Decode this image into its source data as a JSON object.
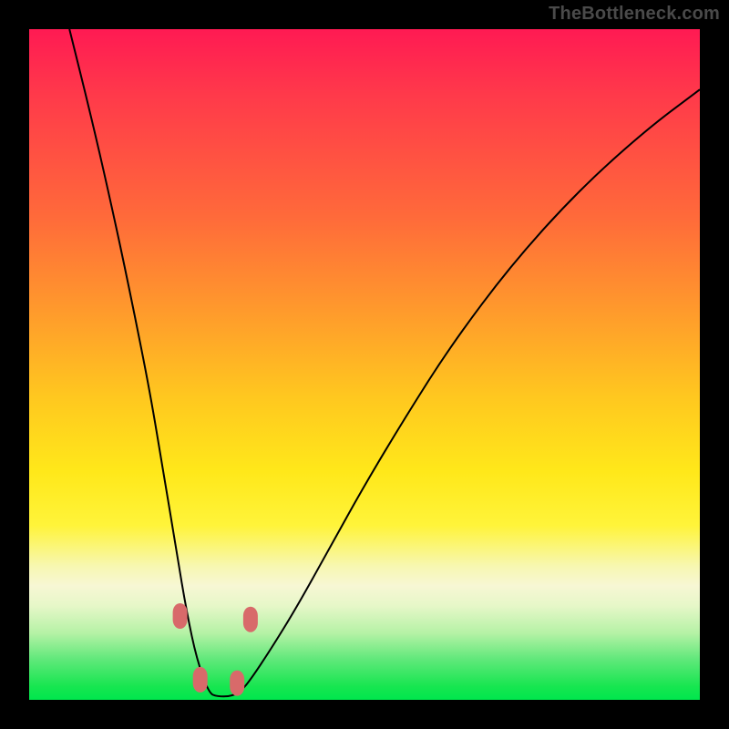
{
  "watermark": "TheBottleneck.com",
  "chart_data": {
    "type": "line",
    "title": "",
    "xlabel": "",
    "ylabel": "",
    "xlim": [
      0,
      100
    ],
    "ylim": [
      0,
      100
    ],
    "grid": false,
    "legend": false,
    "background": "rainbow-vertical-gradient",
    "series": [
      {
        "name": "bottleneck-curve",
        "x": [
          6,
          9,
          12,
          15,
          18,
          20,
          22,
          23.5,
          25,
          26.8,
          28,
          30,
          31.5,
          33,
          36,
          40,
          45,
          50,
          56,
          63,
          72,
          82,
          92,
          100
        ],
        "y": [
          100,
          88,
          75,
          61,
          46,
          34,
          22,
          13,
          6,
          1,
          0.5,
          0.5,
          1.2,
          3,
          7.5,
          14,
          23,
          32,
          42,
          53,
          65,
          76,
          85,
          91
        ]
      }
    ],
    "markers": [
      {
        "name": "left-upper-marker",
        "x": 22.5,
        "y": 12.5
      },
      {
        "name": "left-lower-marker",
        "x": 25.5,
        "y": 3.0
      },
      {
        "name": "right-lower-marker",
        "x": 31.0,
        "y": 2.5
      },
      {
        "name": "right-upper-marker",
        "x": 33.0,
        "y": 12.0
      }
    ],
    "colors": {
      "curve": "#000000",
      "marker": "#d86a6a",
      "gradient_stops": [
        "#ff1a53",
        "#ff9a2c",
        "#ffe81a",
        "#f7f7d4",
        "#00e64d"
      ]
    }
  }
}
